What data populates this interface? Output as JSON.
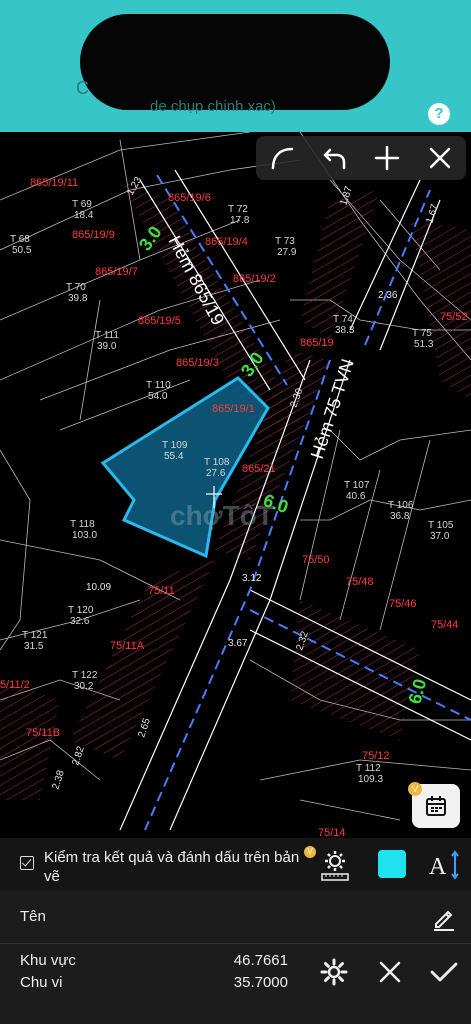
{
  "banner": {
    "text": "de chụp chinh xac)",
    "prefix": "C",
    "help_label": "?"
  },
  "map": {
    "watermark": "chợTốT",
    "roads": [
      {
        "label": "Hẻm 865/19"
      },
      {
        "label": "Hẻm 75 TVN"
      }
    ],
    "widths": [
      "3.0",
      "3.0",
      "6.0",
      "6.0"
    ],
    "parcels_red": [
      "865/19/11",
      "865/19/6",
      "865/19/9",
      "865/19/4",
      "865/19/7",
      "865/19/2",
      "865/19/5",
      "865/19",
      "865/19/3",
      "865/19/1",
      "865/21",
      "75/52",
      "75/50",
      "75/48",
      "75/46",
      "75/44",
      "75/11",
      "75/11A",
      "75/11B",
      "5/11/2",
      "75/12",
      "75/14"
    ],
    "parcels_white": [
      {
        "t": "T",
        "n": "69",
        "a": "18.4"
      },
      {
        "t": "T",
        "n": "72",
        "a": "17.8"
      },
      {
        "t": "T",
        "n": "68",
        "a": "50.5"
      },
      {
        "t": "T",
        "n": "73",
        "a": "27.9"
      },
      {
        "t": "T",
        "n": "70",
        "a": "39.8"
      },
      {
        "t": "T",
        "n": "74",
        "a": "38.3"
      },
      {
        "t": "T",
        "n": "111",
        "a": "39.0"
      },
      {
        "t": "T",
        "n": "75",
        "a": "51.3"
      },
      {
        "t": "T",
        "n": "110",
        "a": "54.0"
      },
      {
        "t": "T",
        "n": "109",
        "a": "55.4"
      },
      {
        "t": "T",
        "n": "108",
        "a": "27.6"
      },
      {
        "t": "T",
        "n": "107",
        "a": "40.6"
      },
      {
        "t": "T",
        "n": "106",
        "a": "36.8"
      },
      {
        "t": "T",
        "n": "105",
        "a": "37.0"
      },
      {
        "t": "T",
        "n": "118",
        "a": "103.0"
      },
      {
        "t": "T",
        "n": "120",
        "a": "32.6"
      },
      {
        "t": "T",
        "n": "121",
        "a": "31.5"
      },
      {
        "t": "T",
        "n": "122",
        "a": "30.2"
      },
      {
        "t": "T",
        "n": "112",
        "a": "109.3"
      }
    ],
    "dims": [
      "1.23",
      "1.87",
      "1.67",
      "2.36",
      "2.30",
      "3.12",
      "10.09",
      "3.67",
      "2.32",
      "2.65",
      "2.82",
      "2.38"
    ]
  },
  "toolbar": {
    "icons": [
      "curve-icon",
      "undo-icon",
      "plus-icon",
      "close-icon"
    ]
  },
  "calendar": {
    "badge": "V"
  },
  "panel": {
    "check_label": "Kiểm tra kết quả và đánh dấu trên bản vẽ",
    "gear_badge": "V",
    "swatch_color": "#1fe3f0",
    "name_label": "Tên",
    "area_label": "Khu vực",
    "area_value": "46.7661",
    "perimeter_label": "Chu vi",
    "perimeter_value": "35.7000"
  }
}
